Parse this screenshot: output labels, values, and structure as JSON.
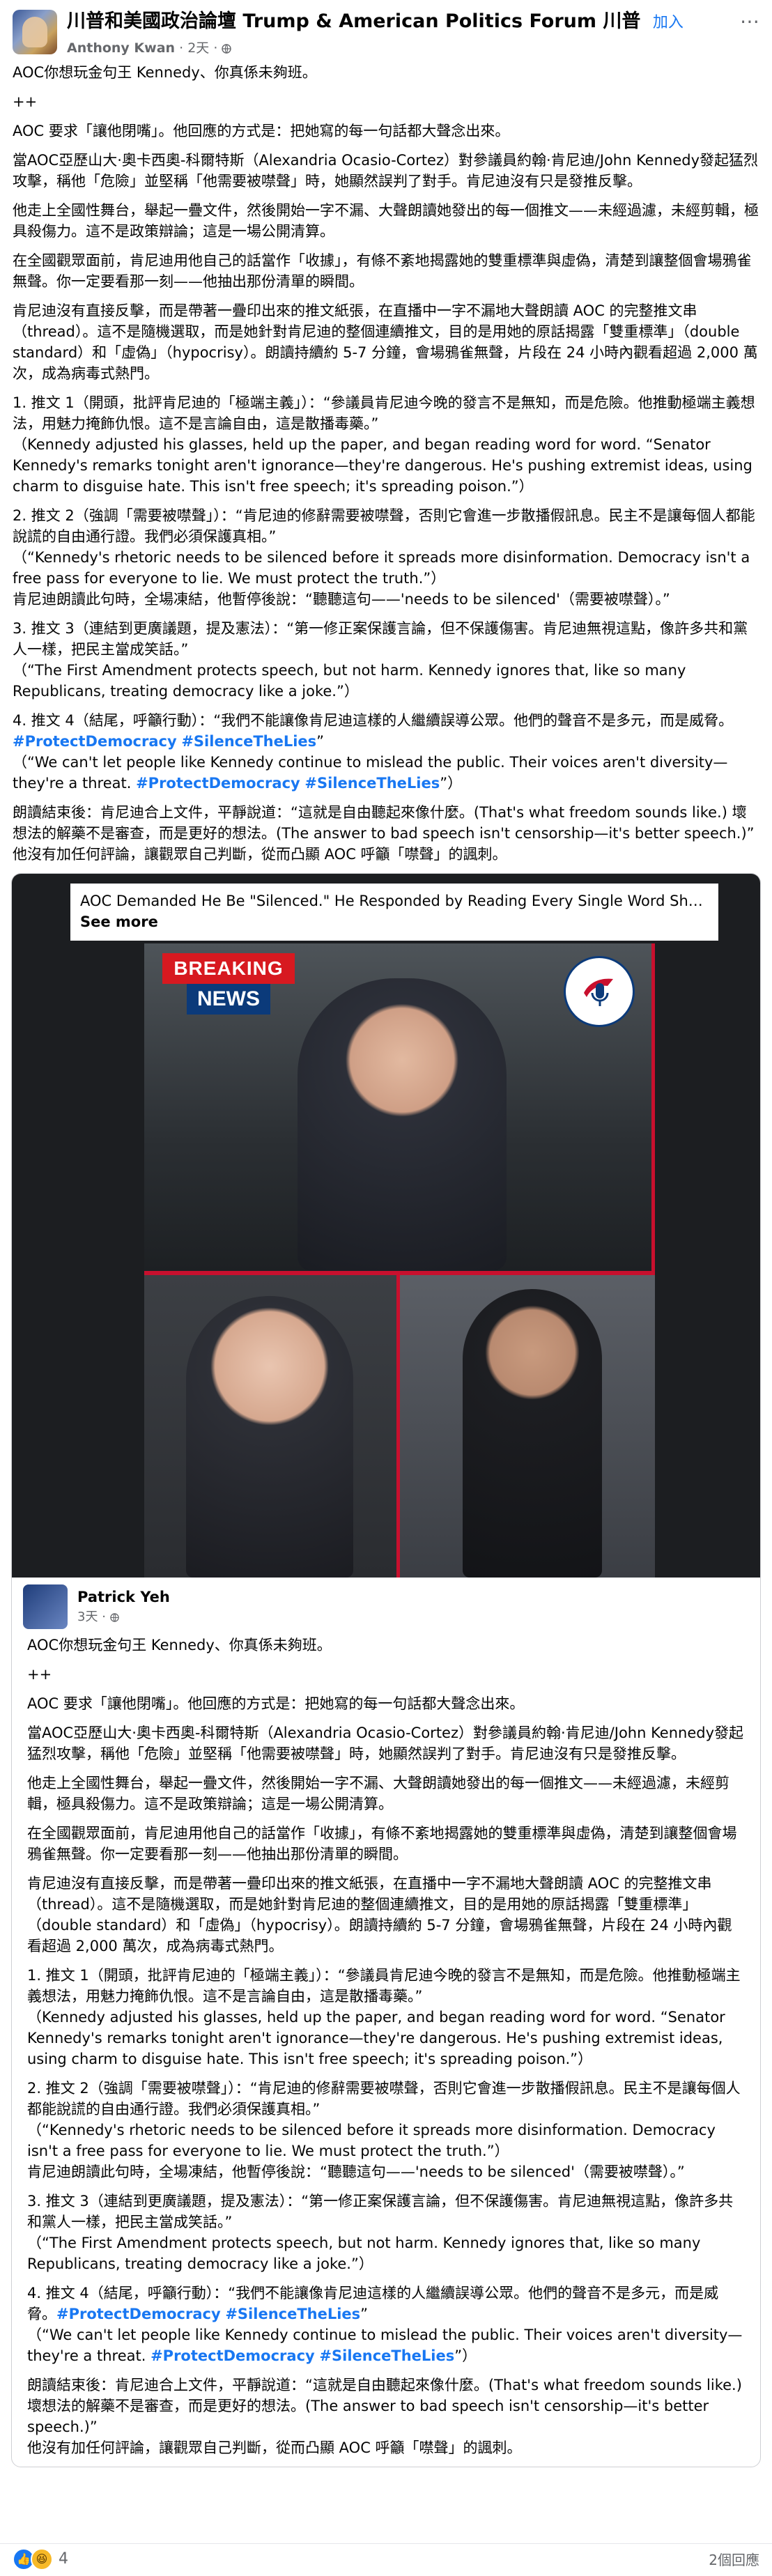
{
  "header": {
    "group_name": "川普和美國政治論壇 Trump & American Politics Forum 川普",
    "join_label": "加入",
    "author": "Anthony Kwan",
    "time": "2天",
    "audience_icon": "globe-icon",
    "more_icon": "more-icon"
  },
  "post_body": [
    "AOC你想玩金句王 Kennedy、你真係未夠班。",
    "++",
    "AOC 要求「讓他閉嘴」。他回應的方式是：把她寫的每一句話都大聲念出來。",
    "當AOC亞歷山大·奧卡西奧-科爾特斯（Alexandria Ocasio-Cortez）對參議員約翰·肯尼迪/John Kennedy發起猛烈攻擊，稱他「危險」並堅稱「他需要被噤聲」時，她顯然誤判了對手。肯尼迪沒有只是發推反擊。",
    "他走上全國性舞台，舉起一疊文件，然後開始一字不漏、大聲朗讀她發出的每一個推文——未經過濾，未經剪輯，極具殺傷力。這不是政策辯論；這是一場公開清算。",
    "在全國觀眾面前，肯尼迪用他自己的話當作「收據」，有條不紊地揭露她的雙重標準與虛偽，清楚到讓整個會場鴉雀無聲。你一定要看那一刻——他抽出那份清單的瞬間。",
    "肯尼迪沒有直接反擊，而是帶著一疊印出來的推文紙張，在直播中一字不漏地大聲朗讀 AOC 的完整推文串（thread）。這不是隨機選取，而是她針對肯尼迪的整個連續推文，目的是用她的原話揭露「雙重標準」（double standard）和「虛偽」（hypocrisy）。朗讀持續約 5-7 分鐘，會場鴉雀無聲，片段在 24 小時內觀看超過 2,000 萬次，成為病毒式熱門。",
    "1. 推文 1（開頭，批評肯尼迪的「極端主義」）：“參議員肯尼迪今晚的發言不是無知，而是危險。他推動極端主義想法，用魅力掩飾仇恨。這不是言論自由，這是散播毒藥。”\n（Kennedy adjusted his glasses, held up the paper, and began reading word for word. “Senator Kennedy's remarks tonight aren't ignorance—they're dangerous. He's pushing extremist ideas, using charm to disguise hate. This isn't free speech; it's spreading poison.”）",
    "2. 推文 2（強調「需要被噤聲」）：“肯尼迪的修辭需要被噤聲，否則它會進一步散播假訊息。民主不是讓每個人都能說謊的自由通行證。我們必須保護真相。”\n（“Kennedy's rhetoric needs to be silenced before it spreads more disinformation. Democracy isn't a free pass for everyone to lie. We must protect the truth.”）\n肯尼迪朗讀此句時，全場凍結，他暫停後說：“聽聽這句——'needs to be silenced'（需要被噤聲）。”",
    "3. 推文 3（連結到更廣議題，提及憲法）：“第一修正案保護言論，但不保護傷害。肯尼迪無視這點，像許多共和黨人一樣，把民主當成笑話。”\n（“The First Amendment protects speech, but not harm. Kennedy ignores that, like so many Republicans, treating democracy like a joke.”）",
    "4. 推文 4（結尾，呼籲行動）：“我們不能讓像肯尼迪這樣的人繼續誤導公眾。他們的聲音不是多元，而是威脅。#ProtectDemocracy #SilenceTheLies”\n（“We can't let people like Kennedy continue to mislead the public. Their voices aren't diversity—they're a threat. #ProtectDemocracy #SilenceTheLies”）",
    "朗讀結束後：肯尼迪合上文件，平靜說道：“這就是自由聽起來像什麼。(That's what freedom sounds like.) 壞想法的解藥不是審查，而是更好的想法。(The answer to bad speech isn't censorship—it's better speech.)”\n他沒有加任何評論，讓觀眾自己判斷，從而凸顯 AOC 呼籲「噤聲」的諷刺。"
  ],
  "link_preview": {
    "title": "AOC Demanded He Be \"Silenced.\" He Responded by Reading Every Single Word She Wrote....",
    "see_more": "See more"
  },
  "photo": {
    "breaking_top": "BREAKING",
    "breaking_bottom": "NEWS"
  },
  "comment": {
    "name": "Patrick Yeh",
    "time": "3天",
    "body": [
      "AOC你想玩金句王 Kennedy、你真係未夠班。",
      "++",
      "AOC 要求「讓他閉嘴」。他回應的方式是：把她寫的每一句話都大聲念出來。",
      "當AOC亞歷山大·奧卡西奧-科爾特斯（Alexandria Ocasio-Cortez）對參議員約翰·肯尼迪/John Kennedy發起猛烈攻擊，稱他「危險」並堅稱「他需要被噤聲」時，她顯然誤判了對手。肯尼迪沒有只是發推反擊。",
      "他走上全國性舞台，舉起一疊文件，然後開始一字不漏、大聲朗讀她發出的每一個推文——未經過濾，未經剪輯，極具殺傷力。這不是政策辯論；這是一場公開清算。",
      "在全國觀眾面前，肯尼迪用他自己的話當作「收據」，有條不紊地揭露她的雙重標準與虛偽，清楚到讓整個會場鴉雀無聲。你一定要看那一刻——他抽出那份清單的瞬間。",
      "肯尼迪沒有直接反擊，而是帶著一疊印出來的推文紙張，在直播中一字不漏地大聲朗讀 AOC 的完整推文串（thread）。這不是隨機選取，而是她針對肯尼迪的整個連續推文，目的是用她的原話揭露「雙重標準」（double standard）和「虛偽」（hypocrisy）。朗讀持續約 5-7 分鐘，會場鴉雀無聲，片段在 24 小時內觀看超過 2,000 萬次，成為病毒式熱門。",
      "1. 推文 1（開頭，批評肯尼迪的「極端主義」）：“參議員肯尼迪今晚的發言不是無知，而是危險。他推動極端主義想法，用魅力掩飾仇恨。這不是言論自由，這是散播毒藥。”\n（Kennedy adjusted his glasses, held up the paper, and began reading word for word. “Senator Kennedy's remarks tonight aren't ignorance—they're dangerous. He's pushing extremist ideas, using charm to disguise hate. This isn't free speech; it's spreading poison.”）",
      "2. 推文 2（強調「需要被噤聲」）：“肯尼迪的修辭需要被噤聲，否則它會進一步散播假訊息。民主不是讓每個人都能說謊的自由通行證。我們必須保護真相。”\n（“Kennedy's rhetoric needs to be silenced before it spreads more disinformation. Democracy isn't a free pass for everyone to lie. We must protect the truth.”）\n肯尼迪朗讀此句時，全場凍結，他暫停後說：“聽聽這句——'needs to be silenced'（需要被噤聲）。”",
      "3. 推文 3（連結到更廣議題，提及憲法）：“第一修正案保護言論，但不保護傷害。肯尼迪無視這點，像許多共和黨人一樣，把民主當成笑話。”\n（“The First Amendment protects speech, but not harm. Kennedy ignores that, like so many Republicans, treating democracy like a joke.”）",
      "4. 推文 4（結尾，呼籲行動）：“我們不能讓像肯尼迪這樣的人繼續誤導公眾。他們的聲音不是多元，而是威脅。#ProtectDemocracy #SilenceTheLies”\n（“We can't let people like Kennedy continue to mislead the public. Their voices aren't diversity—they're a threat. #ProtectDemocracy #SilenceTheLies”）",
      "朗讀結束後：肯尼迪合上文件，平靜說道：“這就是自由聽起來像什麼。(That's what freedom sounds like.) 壞想法的解藥不是審查，而是更好的想法。(The answer to bad speech isn't censorship—it's better speech.)”\n他沒有加任何評論，讓觀眾自己判斷，從而凸顯 AOC 呼籲「噤聲」的諷刺。"
    ]
  },
  "footer": {
    "reaction_count": "4",
    "comments_label": "2個回應",
    "reaction_icons": [
      "like-icon",
      "haha-icon"
    ]
  },
  "colors": {
    "accent": "#1877f2",
    "breaking_red": "#d71920",
    "breaking_blue": "#0b3a7a"
  }
}
